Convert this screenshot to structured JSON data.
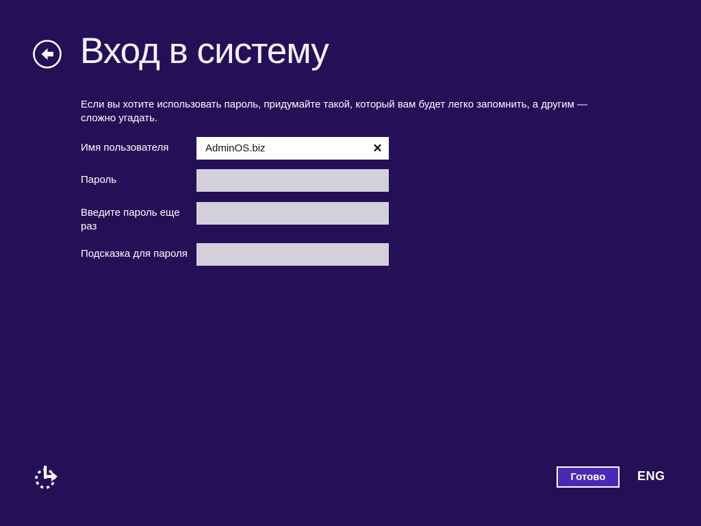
{
  "colors": {
    "background": "#251058",
    "button_fill": "#4b28b4",
    "input_empty": "#d3d0dc",
    "input_filled": "#ffffff",
    "text": "#ffffff"
  },
  "header": {
    "title": "Вход в систему",
    "back_icon": "back-arrow-in-circle"
  },
  "intro": {
    "text": "Если вы хотите использовать пароль, придумайте такой, который вам будет легко запомнить, а другим — сложно угадать."
  },
  "form": {
    "fields": [
      {
        "label": "Имя пользователя",
        "value": "AdminOS.biz",
        "state": "filled"
      },
      {
        "label": "Пароль",
        "value": "",
        "state": "empty"
      },
      {
        "label": "Введите пароль еще раз",
        "value": "",
        "state": "empty"
      },
      {
        "label": "Подсказка для пароля",
        "value": "",
        "state": "empty"
      }
    ],
    "clear_icon_glyph": "✕"
  },
  "footer": {
    "done_button": "Готово",
    "language_indicator": "ENG",
    "ease_of_access_icon": "ease-of-access"
  }
}
